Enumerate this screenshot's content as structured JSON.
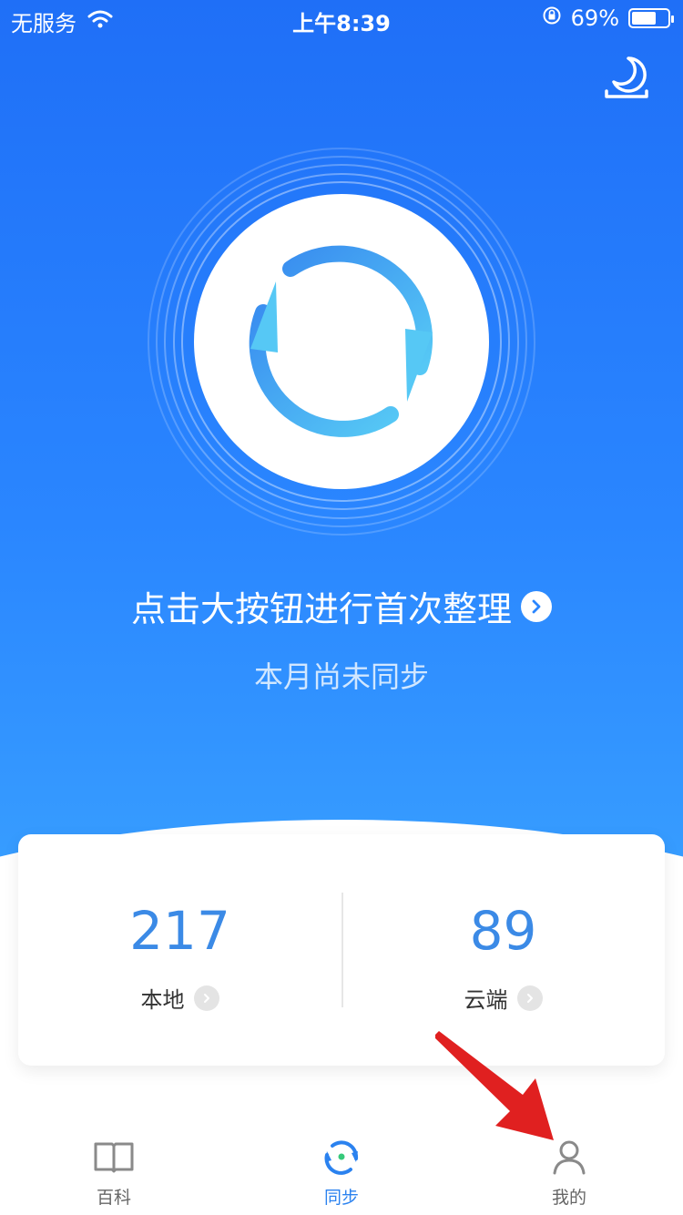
{
  "status_bar": {
    "carrier": "无服务",
    "time": "上午8:39",
    "battery_percent": "69%",
    "battery_level": 0.69
  },
  "header": {
    "night_mode_icon": "moon-icon"
  },
  "sync": {
    "prompt": "点击大按钮进行首次整理",
    "status": "本月尚未同步"
  },
  "stats": {
    "local": {
      "value": "217",
      "label": "本地"
    },
    "cloud": {
      "value": "89",
      "label": "云端"
    }
  },
  "tabbar": {
    "tabs": [
      {
        "label": "百科",
        "icon": "book-icon",
        "active": false
      },
      {
        "label": "同步",
        "icon": "sync-icon",
        "active": true
      },
      {
        "label": "我的",
        "icon": "profile-icon",
        "active": false
      }
    ]
  },
  "colors": {
    "primary": "#1f6ff7",
    "accent": "#3b8ae6",
    "sync_ring": "#4aa3f5",
    "annotation_arrow": "#e02020"
  }
}
